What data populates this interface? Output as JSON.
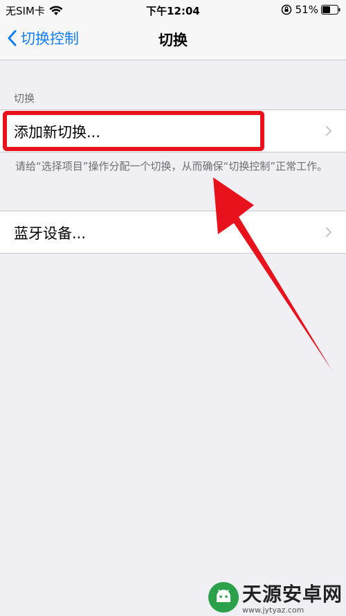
{
  "status": {
    "carrier": "无SIM卡",
    "time": "下午12:04",
    "battery": "51%"
  },
  "nav": {
    "back_label": "切换控制",
    "title": "切换"
  },
  "section": {
    "header": "切换"
  },
  "cells": {
    "add_new": "添加新切换...",
    "bluetooth": "蓝牙设备..."
  },
  "footer": "请给“选择项目”操作分配一个切换，从而确保“切换控制”正常工作。",
  "watermark": {
    "name": "天源安卓网",
    "url": "www.jytyaz.com"
  },
  "colors": {
    "accent": "#157efb",
    "highlight": "#e8121d",
    "background": "#efeff4"
  }
}
